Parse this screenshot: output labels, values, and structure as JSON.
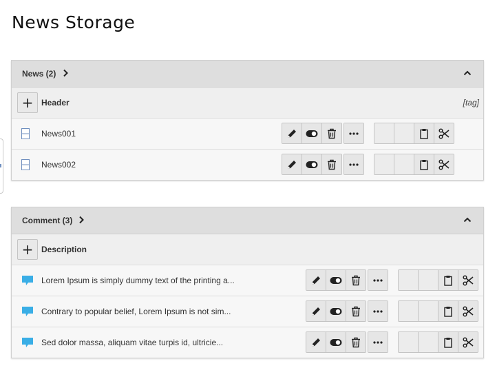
{
  "page": {
    "title": "News Storage"
  },
  "news_panel": {
    "title": "News (2)",
    "header_row": {
      "title": "Header",
      "tag": "[tag]"
    },
    "items": [
      {
        "label": "News001",
        "icon": "page-icon"
      },
      {
        "label": "News002",
        "icon": "page-icon"
      }
    ]
  },
  "comment_panel": {
    "title": "Comment (3)",
    "header_row": {
      "title": "Description"
    },
    "items": [
      {
        "label": "Lorem Ipsum is simply dummy text of the printing a...",
        "icon": "speech-bubble-icon"
      },
      {
        "label": "Contrary to popular belief, Lorem Ipsum is not sim...",
        "icon": "speech-bubble-icon"
      },
      {
        "label": "Sed dolor massa, aliquam vitae turpis id, ultricie...",
        "icon": "speech-bubble-icon"
      }
    ]
  },
  "icons": {
    "add": "plus-icon",
    "row_actions": [
      "pencil-icon",
      "toggle-icon",
      "trash-icon",
      "ellipsis-icon"
    ],
    "clipboard_actions": [
      "clipboard-icon",
      "scissors-icon"
    ],
    "expand": "chevron-right-icon",
    "collapse": "chevron-up-icon"
  },
  "colors": {
    "page_icon": "#6f8fbf",
    "comment_icon": "#3aaee6"
  }
}
